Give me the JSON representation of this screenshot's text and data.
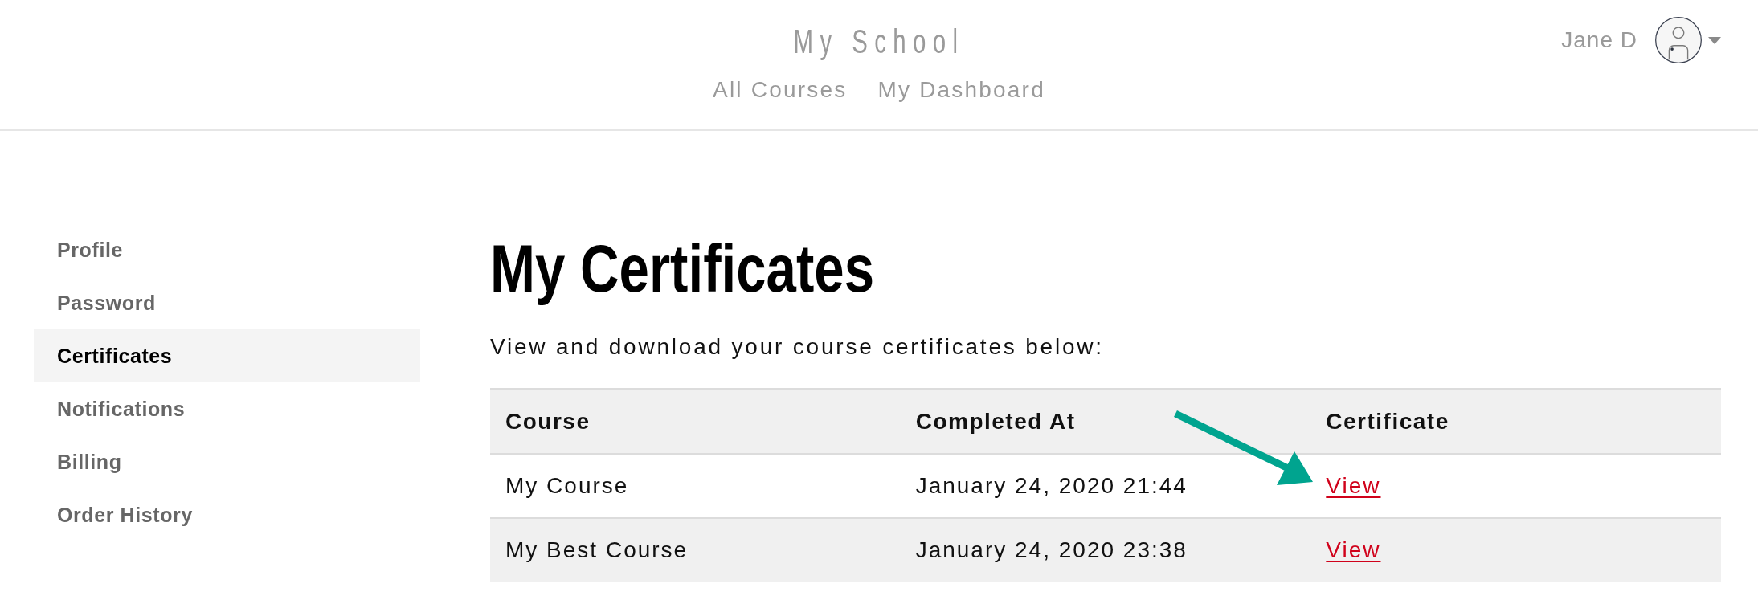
{
  "header": {
    "logo": "My School",
    "nav": [
      {
        "label": "All Courses"
      },
      {
        "label": "My Dashboard"
      }
    ],
    "user": {
      "name": "Jane D"
    }
  },
  "sidebar": {
    "items": [
      {
        "label": "Profile",
        "selected": false
      },
      {
        "label": "Password",
        "selected": false
      },
      {
        "label": "Certificates",
        "selected": true
      },
      {
        "label": "Notifications",
        "selected": false
      },
      {
        "label": "Billing",
        "selected": false
      },
      {
        "label": "Order History",
        "selected": false
      }
    ]
  },
  "main": {
    "title": "My Certificates",
    "subtitle": "View and download your course certificates below:",
    "table": {
      "columns": [
        "Course",
        "Completed At",
        "Certificate"
      ],
      "rows": [
        {
          "course": "My Course",
          "completed_at": "January 24, 2020 21:44",
          "certificate": "View"
        },
        {
          "course": "My Best Course",
          "completed_at": "January 24, 2020 23:38",
          "certificate": "View"
        }
      ]
    },
    "annotations": [
      {
        "kind": "arrow"
      }
    ]
  }
}
